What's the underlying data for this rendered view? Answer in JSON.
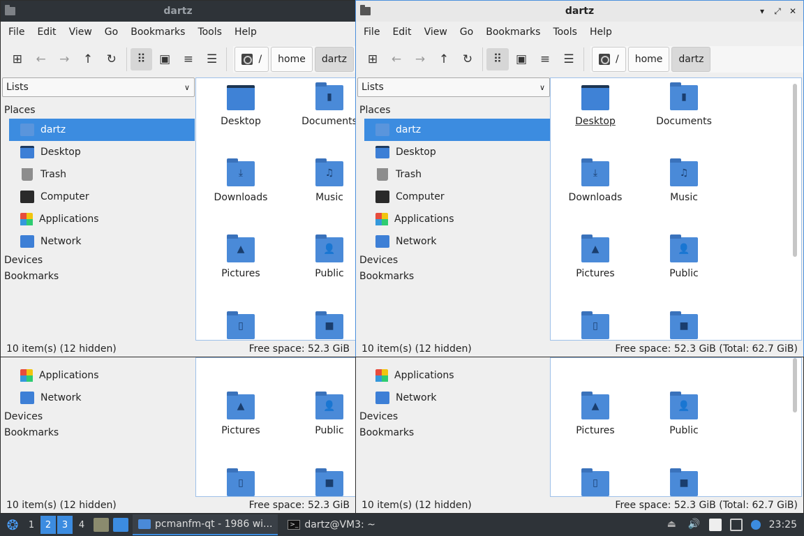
{
  "window": {
    "title": "dartz",
    "controls": [
      "▾",
      "⤢",
      "✕"
    ]
  },
  "menu": [
    "File",
    "Edit",
    "View",
    "Go",
    "Bookmarks",
    "Tools",
    "Help"
  ],
  "toolbar": {
    "icons": [
      "new-tab-icon",
      "back-icon",
      "forward-icon",
      "up-icon",
      "reload-icon",
      "icon-view-icon",
      "thumbnail-view-icon",
      "compact-view-icon",
      "detailed-list-icon"
    ]
  },
  "path": {
    "root": "/",
    "segments": [
      "home",
      "dartz"
    ]
  },
  "sidebar": {
    "mode": "Lists",
    "places_label": "Places",
    "places": [
      {
        "label": "dartz",
        "icon": "home-folder-icon",
        "selected": true
      },
      {
        "label": "Desktop",
        "icon": "desktop-icon"
      },
      {
        "label": "Trash",
        "icon": "trash-icon"
      },
      {
        "label": "Computer",
        "icon": "computer-icon"
      },
      {
        "label": "Applications",
        "icon": "applications-icon"
      },
      {
        "label": "Network",
        "icon": "network-icon"
      }
    ],
    "devices_label": "Devices",
    "bookmarks_label": "Bookmarks"
  },
  "files": [
    {
      "name": "Desktop",
      "icon": "desktop-folder-icon"
    },
    {
      "name": "Documents",
      "icon": "documents-folder-icon"
    },
    {
      "name": "Downloads",
      "icon": "downloads-folder-icon"
    },
    {
      "name": "Music",
      "icon": "music-folder-icon"
    },
    {
      "name": "Pictures",
      "icon": "pictures-folder-icon"
    },
    {
      "name": "Public",
      "icon": "public-folder-icon"
    },
    {
      "name": "",
      "icon": "templates-folder-icon"
    },
    {
      "name": "",
      "icon": "videos-folder-icon"
    }
  ],
  "status": {
    "items": "10 item(s) (12 hidden)",
    "free": "Free space: 52.3 GiB",
    "free_full": "Free space: 52.3 GiB (Total: 62.7 GiB)"
  },
  "taskbar": {
    "workspaces": [
      "1",
      "2",
      "3",
      "4"
    ],
    "tasks": [
      {
        "label": "pcmanfm-qt - 1986 wi...",
        "active": true
      },
      {
        "label": "dartz@VM3: ~",
        "active": false
      }
    ],
    "clock": "23:25"
  }
}
